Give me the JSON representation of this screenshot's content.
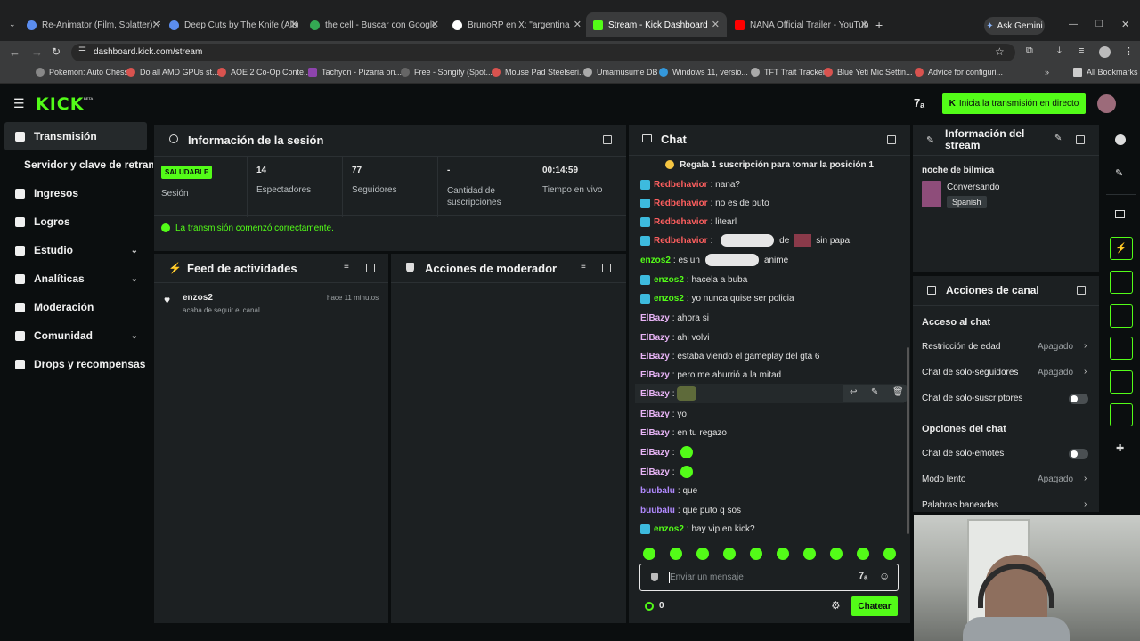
{
  "browser": {
    "tabs": [
      {
        "label": "Re-Animator (Film, Splatter): Re",
        "color": "#5b8def"
      },
      {
        "label": "Deep Cuts by The Knife (Album",
        "color": "#5b8def"
      },
      {
        "label": "the cell - Buscar con Google",
        "color": "#34a853"
      },
      {
        "label": "BrunoRP en X: \"argentina",
        "color": "#ffffff"
      },
      {
        "label": "Stream - Kick Dashboard",
        "color": "#53fc18"
      },
      {
        "label": "NANA Official Trailer - YouTube",
        "color": "#ff0000"
      }
    ],
    "ask_gemini": "Ask Gemini",
    "url": "dashboard.kick.com/stream",
    "bookmarks": [
      "Pokemon: Auto Chess",
      "Do all AMD GPUs st...",
      "AOE 2 Co-Op Conte...",
      "Tachyon - Pizarra on...",
      "Free - Songify (Spot...",
      "Mouse Pad Steelseri...",
      "Umamusume DB",
      "Windows 11, versio...",
      "TFT Trait Tracker",
      "Blue Yeti Mic Settin...",
      "Advice for configuri..."
    ],
    "all_bookmarks": "All Bookmarks"
  },
  "header": {
    "logo": "KICK",
    "beta": "BETA",
    "live_button": "Inicia la transmisión en directo"
  },
  "sidebar": {
    "items": [
      "Transmisión",
      "Servidor y clave de retransmisión",
      "Ingresos",
      "Logros",
      "Estudio",
      "Analíticas",
      "Moderación",
      "Comunidad",
      "Drops y recompensas"
    ]
  },
  "session": {
    "title": "Información de la sesión",
    "status": "SALUDABLE",
    "status_label": "Sesión",
    "stats": [
      {
        "value": "14",
        "label": "Espectadores"
      },
      {
        "value": "77",
        "label": "Seguidores"
      },
      {
        "value": "-",
        "label": "Cantidad de suscripciones"
      },
      {
        "value": "00:14:59",
        "label": "Tiempo en vivo"
      }
    ],
    "message": "La transmisión comenzó correctamente."
  },
  "activity": {
    "title": "Feed de actividades",
    "item_user": "enzos2",
    "item_time": "hace 11 minutos",
    "item_desc": "acaba de seguir el canal"
  },
  "mod_actions": {
    "title": "Acciones de moderador"
  },
  "chat": {
    "title": "Chat",
    "gift_banner": "Regala 1 suscripción para tomar la posición 1",
    "messages": [
      {
        "user": "Redbehavior",
        "text": "nana?",
        "color": "#ff5f5f",
        "badge": true
      },
      {
        "user": "Redbehavior",
        "text": "no es de puto",
        "color": "#ff5f5f",
        "badge": true
      },
      {
        "user": "Redbehavior",
        "text": "litearl",
        "color": "#ff5f5f",
        "badge": true
      },
      {
        "user": "Redbehavior",
        "text": "de",
        "color": "#ff5f5f",
        "badge": true
      },
      {
        "user": "enzos2",
        "text": "es un",
        "color": "#53fc18",
        "badge": false
      },
      {
        "user": "enzos2",
        "text": "hacela a buba",
        "color": "#53fc18",
        "badge": true
      },
      {
        "user": "enzos2",
        "text": "yo nunca quise ser policia",
        "color": "#53fc18",
        "badge": true
      },
      {
        "user": "ElBazy",
        "text": "ahora si",
        "color": "#e7b3f5",
        "badge": false
      },
      {
        "user": "ElBazy",
        "text": "ahi volvi",
        "color": "#e7b3f5",
        "badge": false
      },
      {
        "user": "ElBazy",
        "text": "estaba viendo el gameplay del gta 6",
        "color": "#e7b3f5",
        "badge": false
      },
      {
        "user": "ElBazy",
        "text": "pero me aburrió a la mitad",
        "color": "#e7b3f5",
        "badge": false
      },
      {
        "user": "ElBazy",
        "text": "",
        "color": "#e7b3f5",
        "badge": false
      },
      {
        "user": "ElBazy",
        "text": "yo",
        "color": "#e7b3f5",
        "badge": false
      },
      {
        "user": "ElBazy",
        "text": "en tu regazo",
        "color": "#e7b3f5",
        "badge": false
      },
      {
        "user": "ElBazy",
        "text": "",
        "color": "#e7b3f5",
        "badge": false
      },
      {
        "user": "ElBazy",
        "text": "",
        "color": "#e7b3f5",
        "badge": false
      },
      {
        "user": "buubalu",
        "text": "que",
        "color": "#b18aff",
        "badge": false
      },
      {
        "user": "buubalu",
        "text": "que puto q sos",
        "color": "#b18aff",
        "badge": false
      },
      {
        "user": "enzos2",
        "text": "hay vip en kick?",
        "color": "#53fc18",
        "badge": true
      }
    ],
    "extra_text_1": "sin papa",
    "extra_text_2": "anime",
    "input_placeholder": "Enviar un mensaje",
    "points": "0",
    "send_button": "Chatear"
  },
  "stream_info": {
    "title": "Información del stream",
    "stream_title": "noche de bilmica",
    "category": "Conversando",
    "language": "Spanish"
  },
  "channel_actions": {
    "title": "Acciones de canal",
    "chat_access": "Acceso al chat",
    "rows1": [
      {
        "label": "Restricción de edad",
        "value": "Apagado"
      },
      {
        "label": "Chat de solo-seguidores",
        "value": "Apagado"
      },
      {
        "label": "Chat de solo-suscriptores",
        "value": ""
      }
    ],
    "chat_options": "Opciones del chat",
    "rows2": [
      {
        "label": "Chat de solo-emotes",
        "value": ""
      },
      {
        "label": "Modo lento",
        "value": "Apagado"
      },
      {
        "label": "Palabras baneadas",
        "value": ""
      }
    ]
  }
}
